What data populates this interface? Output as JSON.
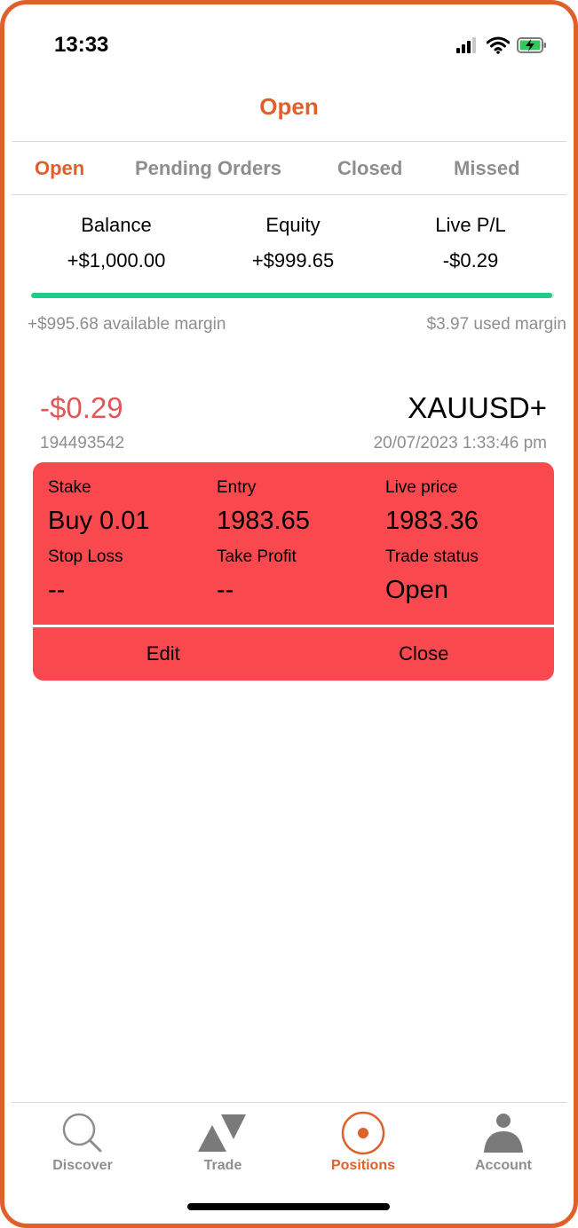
{
  "status_bar": {
    "time": "13:33",
    "icons": [
      "cellular-signal-icon",
      "wifi-icon",
      "battery-charging-icon"
    ]
  },
  "header": {
    "title": "Open"
  },
  "tabs": [
    {
      "label": "Open",
      "active": true
    },
    {
      "label": "Pending Orders",
      "active": false
    },
    {
      "label": "Closed",
      "active": false
    },
    {
      "label": "Missed",
      "active": false
    }
  ],
  "summary": {
    "balance": {
      "label": "Balance",
      "value": "+$1,000.00"
    },
    "equity": {
      "label": "Equity",
      "value": "+$999.65"
    },
    "live_pl": {
      "label": "Live P/L",
      "value": "-$0.29"
    }
  },
  "margin": {
    "available": "+$995.68 available margin",
    "used": "$3.97 used margin",
    "bar_fill_fraction": 0.996,
    "bar_color": "#21cc8a"
  },
  "position": {
    "pl": "-$0.29",
    "symbol": "XAUUSD+",
    "id": "194493542",
    "timestamp": "20/07/2023 1:33:46 pm",
    "card_color": "#f9494e",
    "fields": {
      "stake": {
        "label": "Stake",
        "value": "Buy 0.01"
      },
      "entry": {
        "label": "Entry",
        "value": "1983.65"
      },
      "live_price": {
        "label": "Live price",
        "value": "1983.36"
      },
      "stop_loss": {
        "label": "Stop Loss",
        "value": "--"
      },
      "take_profit": {
        "label": "Take Profit",
        "value": "--"
      },
      "trade_status": {
        "label": "Trade status",
        "value": "Open"
      }
    },
    "edit_label": "Edit",
    "close_label": "Close"
  },
  "nav": {
    "items": [
      {
        "label": "Discover",
        "icon": "magnifier-icon",
        "active": false
      },
      {
        "label": "Trade",
        "icon": "triangles-icon",
        "active": false
      },
      {
        "label": "Positions",
        "icon": "target-circle-icon",
        "active": true
      },
      {
        "label": "Account",
        "icon": "person-icon",
        "active": false
      }
    ]
  },
  "colors": {
    "accent": "#e0602a",
    "loss": "#e05757",
    "inactive": "#8e8e8e"
  }
}
